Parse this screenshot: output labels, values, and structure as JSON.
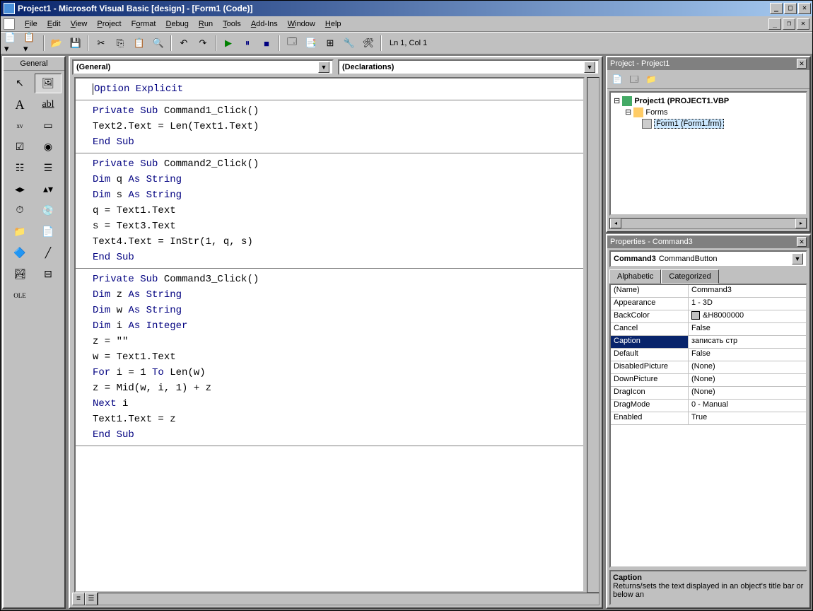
{
  "title": "Project1 - Microsoft Visual Basic [design] - [Form1 (Code)]",
  "menus": [
    "File",
    "Edit",
    "View",
    "Project",
    "Format",
    "Debug",
    "Run",
    "Tools",
    "Add-Ins",
    "Window",
    "Help"
  ],
  "status": "Ln 1, Col 1",
  "toolbox_title": "General",
  "dd_left": "(General)",
  "dd_right": "(Declarations)",
  "code_blocks": [
    [
      {
        "t": "Option Explicit",
        "kw": [
          0,
          15
        ]
      }
    ],
    [
      {
        "t": "Private Sub Command1_Click()",
        "kw": [
          0,
          11
        ]
      },
      {
        "t": " Text2.Text = Len(Text1.Text)"
      },
      {
        "t": "End Sub",
        "kw": [
          0,
          7
        ]
      }
    ],
    [
      {
        "t": "Private Sub Command2_Click()",
        "kw": [
          0,
          11
        ]
      },
      {
        "t": "Dim q As String",
        "kw_multi": [
          [
            0,
            3
          ],
          [
            6,
            15
          ]
        ]
      },
      {
        "t": "Dim s As String",
        "kw_multi": [
          [
            0,
            3
          ],
          [
            6,
            15
          ]
        ]
      },
      {
        "t": " q = Text1.Text"
      },
      {
        "t": " s = Text3.Text"
      },
      {
        "t": " Text4.Text = InStr(1, q, s)"
      },
      {
        "t": "End Sub",
        "kw": [
          0,
          7
        ]
      }
    ],
    [
      {
        "t": "Private Sub Command3_Click()",
        "kw": [
          0,
          11
        ]
      },
      {
        "t": "Dim z As String",
        "kw_multi": [
          [
            0,
            3
          ],
          [
            6,
            15
          ]
        ]
      },
      {
        "t": "Dim w As String",
        "kw_multi": [
          [
            0,
            3
          ],
          [
            6,
            15
          ]
        ]
      },
      {
        "t": "Dim i As Integer",
        "kw_multi": [
          [
            0,
            3
          ],
          [
            6,
            16
          ]
        ]
      },
      {
        "t": " z = \"\""
      },
      {
        "t": " w = Text1.Text"
      },
      {
        "t": "For i = 1 To Len(w)",
        "kw_multi": [
          [
            0,
            3
          ],
          [
            10,
            12
          ]
        ]
      },
      {
        "t": " z = Mid(w, i, 1) + z"
      },
      {
        "t": "Next i",
        "kw": [
          0,
          4
        ]
      },
      {
        "t": " Text1.Text = z"
      },
      {
        "t": "End Sub",
        "kw": [
          0,
          7
        ]
      }
    ]
  ],
  "project_pane": {
    "title": "Project - Project1",
    "root": "Project1 (PROJECT1.VBP",
    "folder": "Forms",
    "form": "Form1 (Form1.frm)"
  },
  "props_pane": {
    "title": "Properties - Command3",
    "combo_name": "Command3",
    "combo_type": "CommandButton",
    "tabs": [
      "Alphabetic",
      "Categorized"
    ],
    "rows": [
      {
        "n": "(Name)",
        "v": "Command3"
      },
      {
        "n": "Appearance",
        "v": "1 - 3D"
      },
      {
        "n": "BackColor",
        "v": "&H8000000"
      },
      {
        "n": "Cancel",
        "v": "False"
      },
      {
        "n": "Caption",
        "v": "записать стр",
        "sel": true
      },
      {
        "n": "Default",
        "v": "False"
      },
      {
        "n": "DisabledPicture",
        "v": "(None)"
      },
      {
        "n": "DownPicture",
        "v": "(None)"
      },
      {
        "n": "DragIcon",
        "v": "(None)"
      },
      {
        "n": "DragMode",
        "v": "0 - Manual"
      },
      {
        "n": "Enabled",
        "v": "True"
      }
    ],
    "desc_title": "Caption",
    "desc_text": "Returns/sets the text displayed in an object's title bar or below an"
  }
}
